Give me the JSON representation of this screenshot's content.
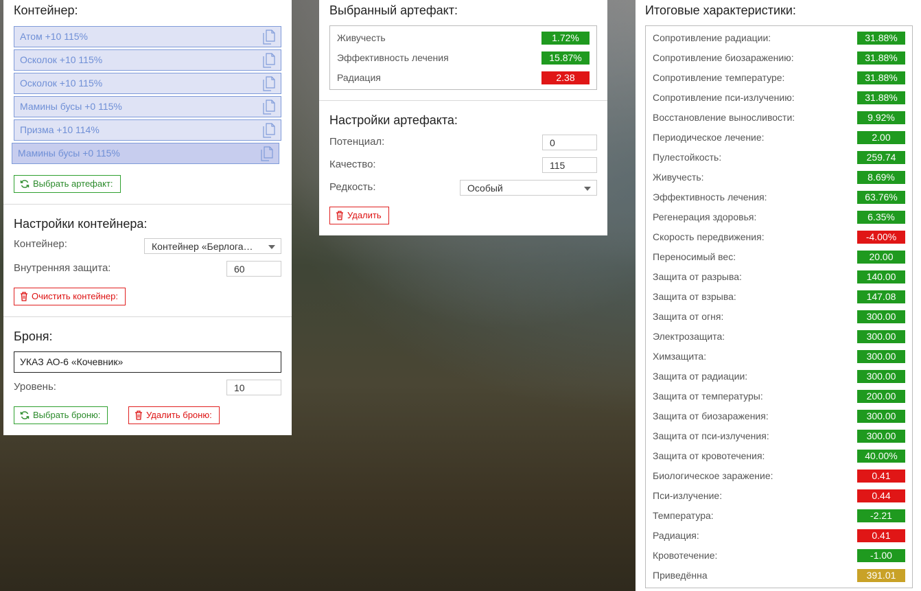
{
  "container_panel": {
    "title": "Контейнер:",
    "artifacts": [
      {
        "label": "Атом +10 115%"
      },
      {
        "label": "Осколок +10 115%"
      },
      {
        "label": "Осколок +10 115%"
      },
      {
        "label": "Мамины бусы +0 115%"
      },
      {
        "label": "Призма +10 114%"
      },
      {
        "label": "Мамины бусы +0 115%"
      }
    ],
    "select_artifact_button": "Выбрать артефакт:",
    "settings_title": "Настройки контейнера:",
    "container_label": "Контейнер:",
    "container_value": "Контейнер «Берлога…",
    "inner_protection_label": "Внутренняя защита:",
    "inner_protection_value": "60",
    "clear_button": "Очистить контейнер:",
    "armor_title": "Броня:",
    "armor_value": "УКАЗ АО-6 «Кочевник»",
    "level_label": "Уровень:",
    "level_value": "10",
    "select_armor_button": "Выбрать броню:",
    "delete_armor_button": "Удалить броню:"
  },
  "selected_artifact": {
    "title": "Выбранный артефакт:",
    "stats": [
      {
        "label": "Живучесть",
        "value": "1.72%",
        "color": "green"
      },
      {
        "label": "Эффективность лечения",
        "value": "15.87%",
        "color": "green"
      },
      {
        "label": "Радиация",
        "value": "2.38",
        "color": "red"
      }
    ],
    "settings_title": "Настройки артефакта:",
    "potential_label": "Потенциал:",
    "potential_value": "0",
    "quality_label": "Качество:",
    "quality_value": "115",
    "rarity_label": "Редкость:",
    "rarity_value": "Особый",
    "delete_button": "Удалить"
  },
  "totals": {
    "title": "Итоговые характеристики:",
    "stats": [
      {
        "label": "Сопротивление радиации:",
        "value": "31.88%",
        "color": "green"
      },
      {
        "label": "Сопротивление биозаражению:",
        "value": "31.88%",
        "color": "green"
      },
      {
        "label": "Сопротивление температуре:",
        "value": "31.88%",
        "color": "green"
      },
      {
        "label": "Сопротивление пси-излучению:",
        "value": "31.88%",
        "color": "green"
      },
      {
        "label": "Восстановление выносливости:",
        "value": "9.92%",
        "color": "green"
      },
      {
        "label": "Периодическое лечение:",
        "value": "2.00",
        "color": "green"
      },
      {
        "label": "Пулестойкость:",
        "value": "259.74",
        "color": "green"
      },
      {
        "label": "Живучесть:",
        "value": "8.69%",
        "color": "green"
      },
      {
        "label": "Эффективность лечения:",
        "value": "63.76%",
        "color": "green"
      },
      {
        "label": "Регенерация здоровья:",
        "value": "6.35%",
        "color": "green"
      },
      {
        "label": "Скорость передвижения:",
        "value": "-4.00%",
        "color": "red"
      },
      {
        "label": "Переносимый вес:",
        "value": "20.00",
        "color": "green"
      },
      {
        "label": "Защита от разрыва:",
        "value": "140.00",
        "color": "green"
      },
      {
        "label": "Защита от взрыва:",
        "value": "147.08",
        "color": "green"
      },
      {
        "label": "Защита от огня:",
        "value": "300.00",
        "color": "green"
      },
      {
        "label": "Электрозащита:",
        "value": "300.00",
        "color": "green"
      },
      {
        "label": "Химзащита:",
        "value": "300.00",
        "color": "green"
      },
      {
        "label": "Защита от радиации:",
        "value": "300.00",
        "color": "green"
      },
      {
        "label": "Защита от температуры:",
        "value": "200.00",
        "color": "green"
      },
      {
        "label": "Защита от биозаражения:",
        "value": "300.00",
        "color": "green"
      },
      {
        "label": "Защита от пси-излучения:",
        "value": "300.00",
        "color": "green"
      },
      {
        "label": "Защита от кровотечения:",
        "value": "40.00%",
        "color": "green"
      },
      {
        "label": "Биологическое заражение:",
        "value": "0.41",
        "color": "red"
      },
      {
        "label": "Пси-излучение:",
        "value": "0.44",
        "color": "red"
      },
      {
        "label": "Температура:",
        "value": "-2.21",
        "color": "green"
      },
      {
        "label": "Радиация:",
        "value": "0.41",
        "color": "red"
      },
      {
        "label": "Кровотечение:",
        "value": "-1.00",
        "color": "green"
      },
      {
        "label": "Приведённа",
        "value": "391.01",
        "color": "yellow"
      }
    ]
  },
  "colors": {
    "green": "#1f9a1f",
    "red": "#e01616",
    "yellow": "#c9a227",
    "artifact_border": "#7f9bd9"
  }
}
